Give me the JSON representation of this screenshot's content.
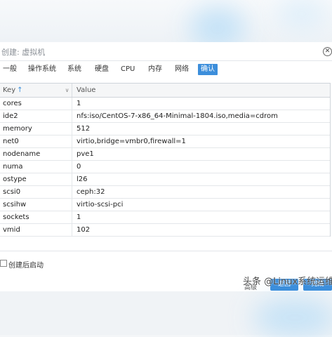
{
  "dialog": {
    "title": "创建: 虚拟机",
    "tabs": [
      "一般",
      "操作系统",
      "系统",
      "硬盘",
      "CPU",
      "内存",
      "网络",
      "确认"
    ],
    "active_tab": "确认"
  },
  "grid": {
    "key_header": "Key",
    "sort_indicator": "↑",
    "value_header": "Value",
    "rows": [
      {
        "key": "cores",
        "value": "1"
      },
      {
        "key": "ide2",
        "value": "nfs:iso/CentOS-7-x86_64-Minimal-1804.iso,media=cdrom"
      },
      {
        "key": "memory",
        "value": "512"
      },
      {
        "key": "net0",
        "value": "virtio,bridge=vmbr0,firewall=1"
      },
      {
        "key": "nodename",
        "value": "pve1"
      },
      {
        "key": "numa",
        "value": "0"
      },
      {
        "key": "ostype",
        "value": "l26"
      },
      {
        "key": "scsi0",
        "value": "ceph:32"
      },
      {
        "key": "scsihw",
        "value": "virtio-scsi-pci"
      },
      {
        "key": "sockets",
        "value": "1"
      },
      {
        "key": "vmid",
        "value": "102"
      }
    ]
  },
  "footer": {
    "autostart_label": "创建后启动",
    "autostart_checked": false,
    "advanced_label": "高级",
    "back_label": "返回",
    "finish_label": "完成"
  },
  "watermark": "头条 @Linux系统运维",
  "colors": {
    "accent": "#3c8edb",
    "border": "#cfd4da"
  }
}
